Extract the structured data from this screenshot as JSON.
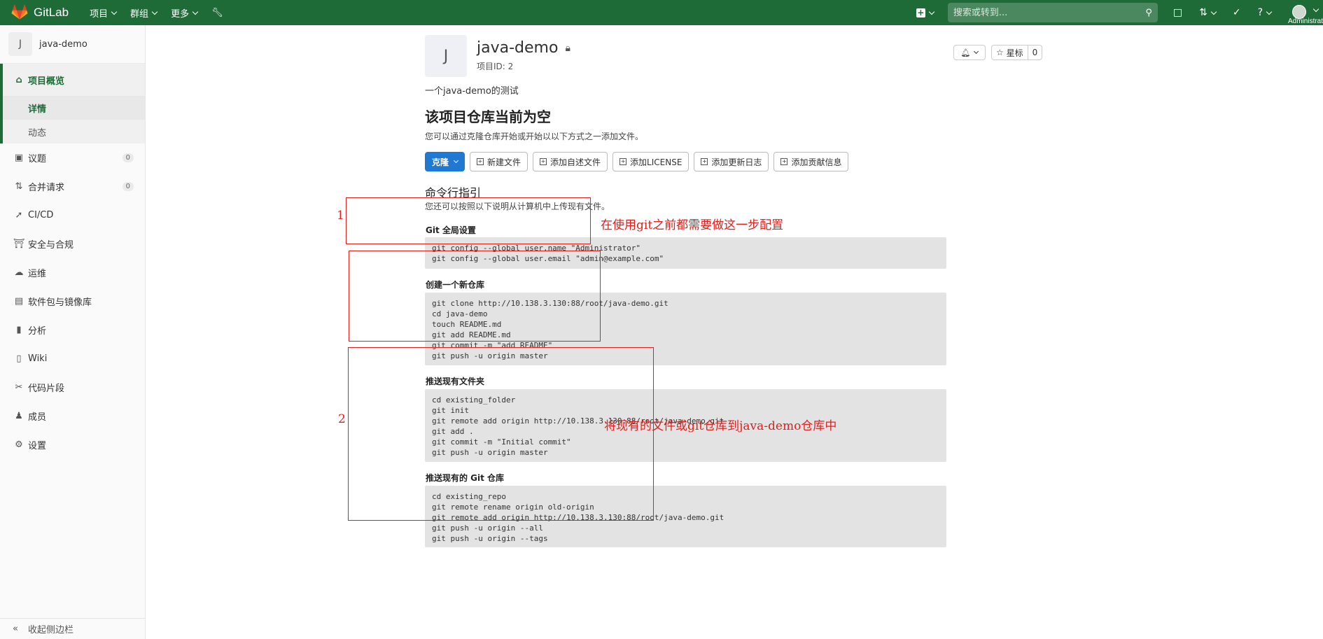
{
  "topbar": {
    "brand": "GitLab",
    "menus": [
      "项目",
      "群组",
      "更多"
    ],
    "search_placeholder": "搜索或转到...",
    "user_label": "Administrator"
  },
  "sidebar": {
    "project_initial": "J",
    "project_name": "java-demo",
    "overview": "项目概览",
    "sub_items": [
      "详情",
      "动态"
    ],
    "items": [
      {
        "label": "议题",
        "count": "0"
      },
      {
        "label": "合并请求",
        "count": "0"
      },
      {
        "label": "CI/CD"
      },
      {
        "label": "安全与合规"
      },
      {
        "label": "运维"
      },
      {
        "label": "软件包与镜像库"
      },
      {
        "label": "分析"
      },
      {
        "label": "Wiki"
      },
      {
        "label": "代码片段"
      },
      {
        "label": "成员"
      },
      {
        "label": "设置"
      }
    ],
    "collapse": "收起侧边栏"
  },
  "project": {
    "initial": "J",
    "name": "java-demo",
    "id_label": "项目ID: 2",
    "description": "一个java-demo的测试",
    "star_label": "星标",
    "star_count": "0"
  },
  "empty": {
    "title": "该项目仓库当前为空",
    "subtitle": "您可以通过克隆仓库开始或开始以以下方式之一添加文件。"
  },
  "buttons": {
    "clone": "克隆",
    "new_file": "新建文件",
    "add_readme": "添加自述文件",
    "add_license": "添加LICENSE",
    "add_changelog": "添加更新日志",
    "add_contributing": "添加贡献信息"
  },
  "cli": {
    "title": "命令行指引",
    "subtitle": "您还可以按照以下说明从计算机中上传现有文件。",
    "sections": [
      {
        "title": "Git 全局设置",
        "code": "git config --global user.name \"Administrator\"\ngit config --global user.email \"admin@example.com\""
      },
      {
        "title": "创建一个新仓库",
        "code": "git clone http://10.138.3.130:88/root/java-demo.git\ncd java-demo\ntouch README.md\ngit add README.md\ngit commit -m \"add README\"\ngit push -u origin master"
      },
      {
        "title": "推送现有文件夹",
        "code": "cd existing_folder\ngit init\ngit remote add origin http://10.138.3.130:88/root/java-demo.git\ngit add .\ngit commit -m \"Initial commit\"\ngit push -u origin master"
      },
      {
        "title": "推送现有的 Git 仓库",
        "code": "cd existing_repo\ngit remote rename origin old-origin\ngit remote add origin http://10.138.3.130:88/root/java-demo.git\ngit push -u origin --all\ngit push -u origin --tags"
      }
    ]
  },
  "annotations": {
    "num1": "1",
    "num2": "2",
    "note1": "在使用git之前都需要做这一步配置",
    "note2": "将现有的文件或git仓库到java-demo仓库中",
    "color": "#e0201c"
  }
}
